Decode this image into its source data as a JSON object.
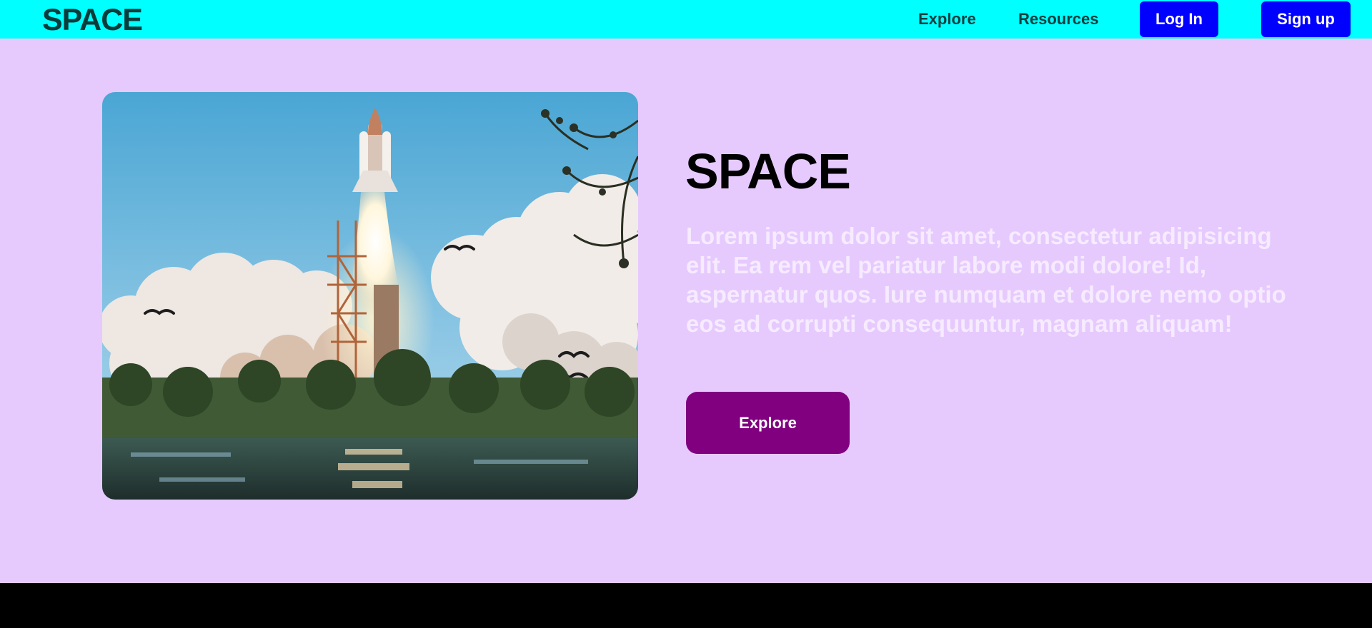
{
  "header": {
    "logo": "SPACE",
    "nav": {
      "explore": "Explore",
      "resources": "Resources"
    },
    "login_label": "Log In",
    "signup_label": "Sign up"
  },
  "hero": {
    "title": "SPACE",
    "text": "Lorem ipsum dolor sit amet, consectetur adipisicing elit. Ea rem vel pariatur labore modi dolore! Id, aspernatur quos. Iure numquam et dolore nemo optio eos ad corrupti consequuntur, magnam aliquam!",
    "cta_label": "Explore",
    "image": {
      "subject": "space-shuttle-launch-photo"
    }
  },
  "colors": {
    "header_bg": "#00ffff",
    "page_bg": "#e6cafe",
    "auth_buttons": "#0000ff",
    "cta_button": "#800080",
    "footer_bg": "#000000"
  }
}
